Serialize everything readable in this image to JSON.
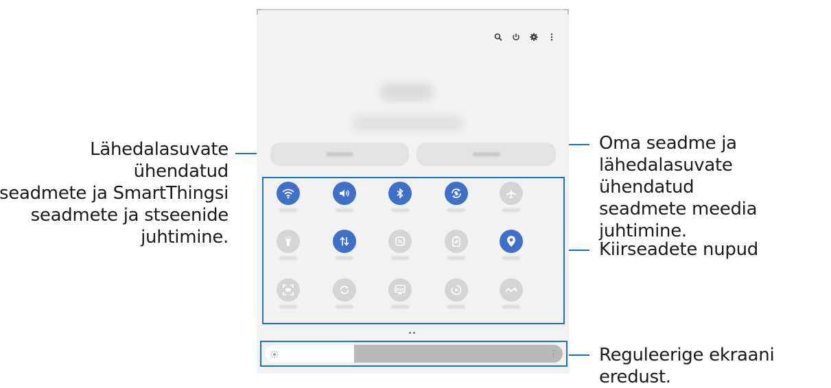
{
  "callouts": {
    "left": [
      "Lähedalasuvate ühendatud",
      "seadmete ja SmartThingsi",
      "seadmete ja stseenide",
      "juhtimine."
    ],
    "right_top": [
      "Oma seadme ja",
      "lähedalasuvate ühendatud",
      "seadmete meedia juhtimine."
    ],
    "right_mid": [
      "Kiirseadete nupud"
    ],
    "right_bot": [
      "Reguleerige ekraani eredust."
    ]
  },
  "top_icons": [
    "search-icon",
    "power-icon",
    "settings-icon",
    "more-options-icon"
  ],
  "quick_settings": [
    {
      "icon": "wifi-icon",
      "state": "on"
    },
    {
      "icon": "sound-icon",
      "state": "on"
    },
    {
      "icon": "bluetooth-icon",
      "state": "on"
    },
    {
      "icon": "auto-rotate-icon",
      "state": "on"
    },
    {
      "icon": "airplane-mode-icon",
      "state": "off"
    },
    {
      "icon": "flashlight-icon",
      "state": "off"
    },
    {
      "icon": "mobile-data-icon",
      "state": "on"
    },
    {
      "icon": "cast-icon",
      "state": "off"
    },
    {
      "icon": "power-saving-icon",
      "state": "off"
    },
    {
      "icon": "location-icon",
      "state": "on"
    },
    {
      "icon": "screen-capture-icon",
      "state": "off"
    },
    {
      "icon": "sync-icon",
      "state": "off"
    },
    {
      "icon": "dex-icon",
      "state": "off"
    },
    {
      "icon": "screen-recorder-icon",
      "state": "off"
    },
    {
      "icon": "nearby-share-icon",
      "state": "off"
    }
  ],
  "brightness": {
    "level": 0.3
  },
  "colors": {
    "accent": "#1a73b8",
    "tile_on": "#3e6fc9",
    "tile_off": "#d5d5d5"
  }
}
